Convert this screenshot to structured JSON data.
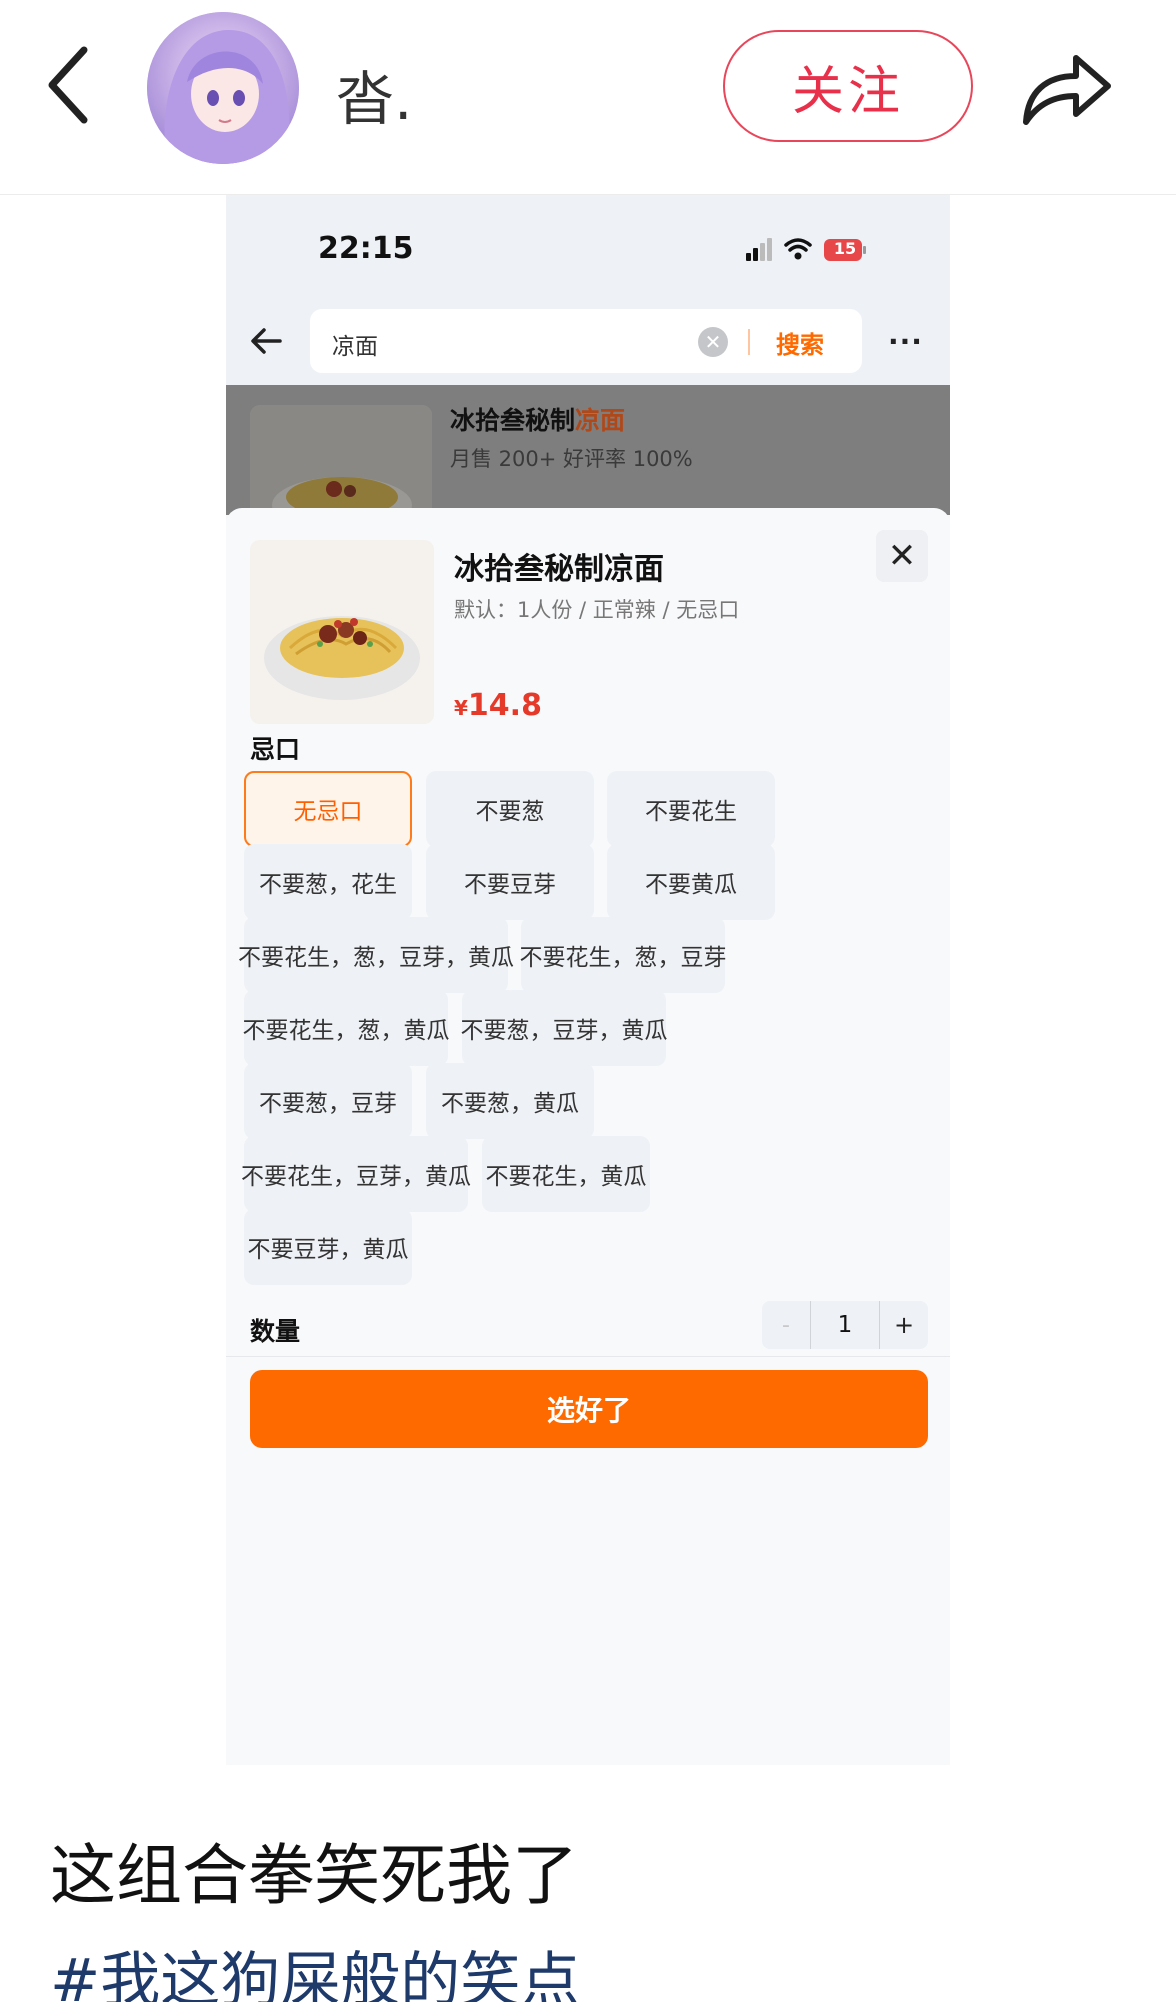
{
  "post": {
    "username": "沓.",
    "follow_label": "关注",
    "caption": "这组合拳笑死我了",
    "hashtag": "#我这狗屎般的笑点"
  },
  "phone": {
    "status": {
      "time": "22:15",
      "battery": "15"
    },
    "search": {
      "query": "凉面",
      "submit_label": "搜索",
      "more": "···"
    },
    "result": {
      "title_prefix": "冰拾叁秘制",
      "title_highlight": "凉面",
      "subtitle": "月售 200+  好评率 100%"
    },
    "sheet": {
      "product_name": "冰拾叁秘制凉面",
      "default_spec": "默认：1人份 / 正常辣 / 无忌口",
      "currency": "¥",
      "price": "14.8",
      "close": "✕",
      "section_label": "忌口",
      "options": [
        {
          "label": "无忌口",
          "selected": true
        },
        {
          "label": "不要葱",
          "selected": false
        },
        {
          "label": "不要花生",
          "selected": false
        },
        {
          "label": "不要葱，花生",
          "selected": false
        },
        {
          "label": "不要豆芽",
          "selected": false
        },
        {
          "label": "不要黄瓜",
          "selected": false
        },
        {
          "label": "不要花生，葱，豆芽，黄瓜",
          "selected": false
        },
        {
          "label": "不要花生，葱，豆芽",
          "selected": false
        },
        {
          "label": "不要花生，葱，黄瓜",
          "selected": false
        },
        {
          "label": "不要葱，豆芽，黄瓜",
          "selected": false
        },
        {
          "label": "不要葱，豆芽",
          "selected": false
        },
        {
          "label": "不要葱，黄瓜",
          "selected": false
        },
        {
          "label": "不要花生，豆芽，黄瓜",
          "selected": false
        },
        {
          "label": "不要花生，黄瓜",
          "selected": false
        },
        {
          "label": "不要豆芽，黄瓜",
          "selected": false
        }
      ],
      "quantity_label": "数量",
      "quantity": "1",
      "minus": "-",
      "plus": "+",
      "confirm_label": "选好了"
    }
  },
  "colors": {
    "accent": "#ff6a00",
    "follow": "#e8304a",
    "price": "#e53a2a",
    "hashtag": "#1e3a6b"
  },
  "icons": [
    "back-chevron-icon",
    "share-arrow-icon",
    "back-arrow-icon",
    "clear-icon",
    "more-icon",
    "close-icon",
    "wifi-icon",
    "signal-icon",
    "battery-icon"
  ]
}
